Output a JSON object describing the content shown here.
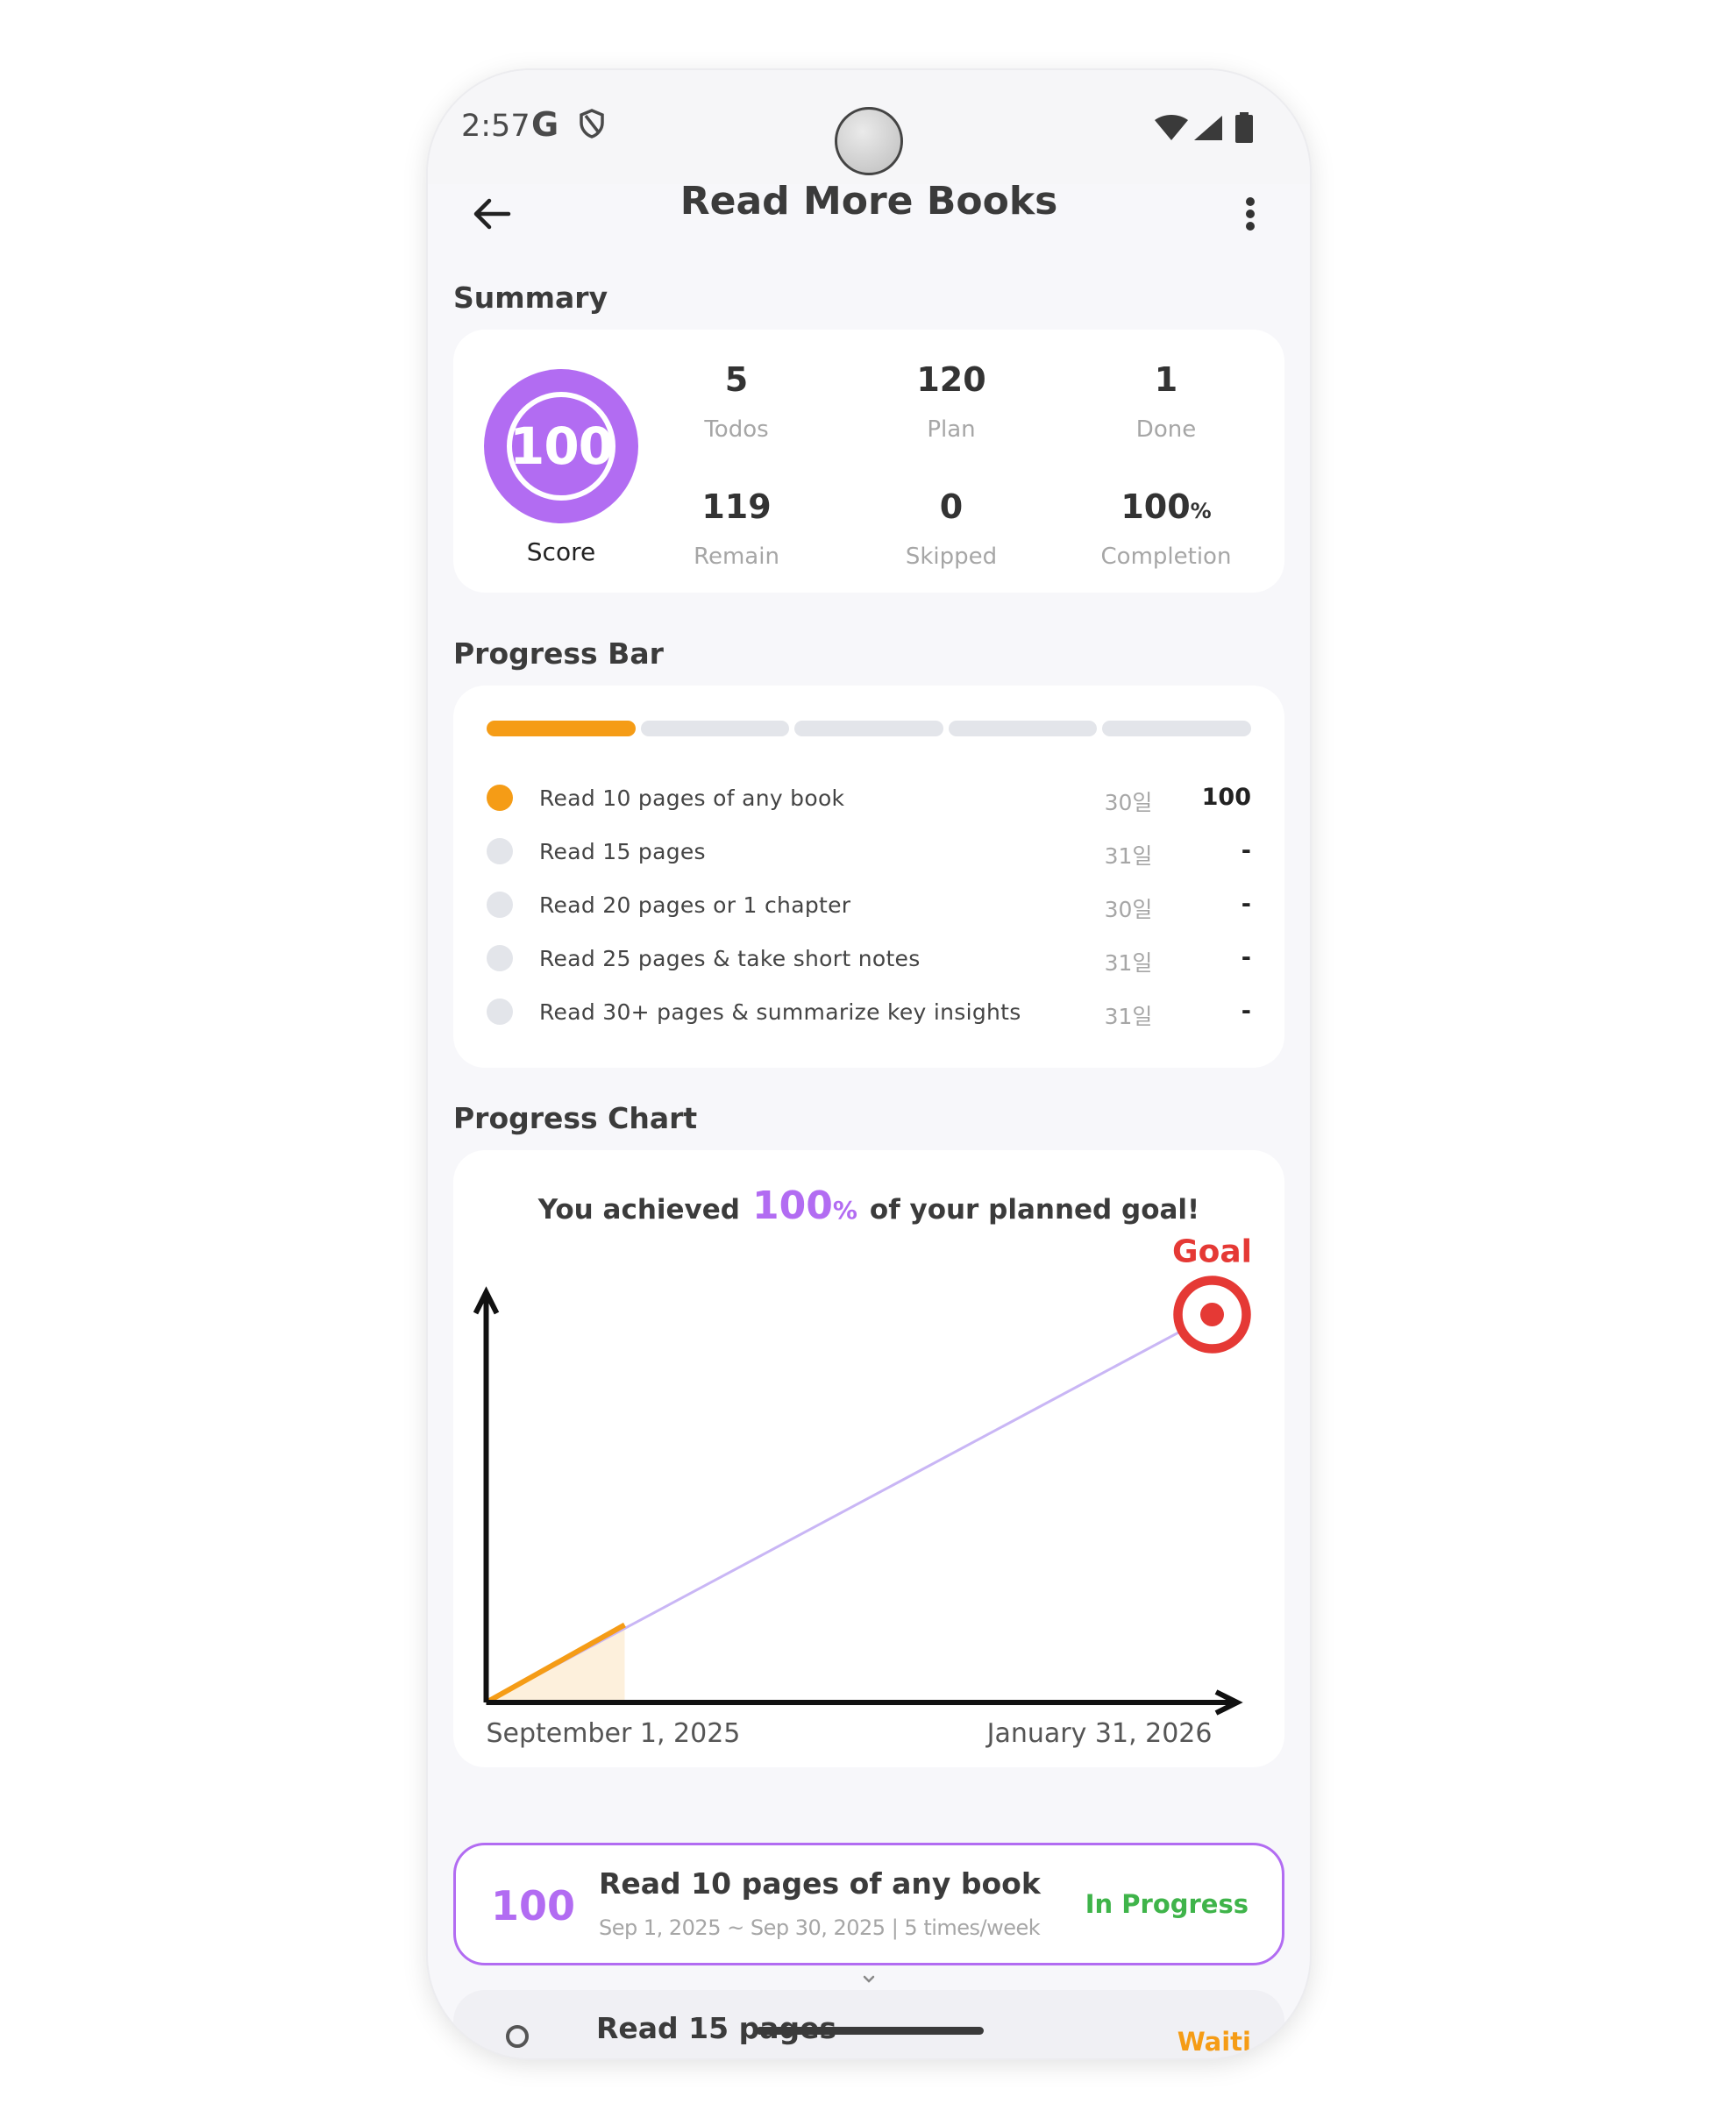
{
  "status_bar": {
    "time": "2:57",
    "g_label": "G",
    "icons": [
      "google-icon",
      "shield-icon",
      "wifi-icon",
      "signal-icon",
      "battery-icon"
    ]
  },
  "app_bar": {
    "title": "Read More Books",
    "back_icon": "arrow-left-icon",
    "menu_icon": "more-vert-icon"
  },
  "summary": {
    "section_title": "Summary",
    "score": "100",
    "score_label": "Score",
    "stats": [
      {
        "value": "5",
        "label": "Todos"
      },
      {
        "value": "120",
        "label": "Plan"
      },
      {
        "value": "1",
        "label": "Done"
      },
      {
        "value": "119",
        "label": "Remain"
      },
      {
        "value": "0",
        "label": "Skipped"
      },
      {
        "value": "100",
        "unit": "%",
        "label": "Completion"
      }
    ]
  },
  "progress_bar": {
    "section_title": "Progress Bar",
    "segments_done": 1,
    "segments_total": 5,
    "tasks": [
      {
        "label": "Read 10 pages of any book",
        "days": "30일",
        "score": "100",
        "active": true
      },
      {
        "label": "Read 15 pages",
        "days": "31일",
        "score": "-",
        "active": false
      },
      {
        "label": "Read 20 pages or 1 chapter",
        "days": "30일",
        "score": "-",
        "active": false
      },
      {
        "label": "Read 25 pages & take short notes",
        "days": "31일",
        "score": "-",
        "active": false
      },
      {
        "label": "Read 30+ pages & summarize key insights",
        "days": "31일",
        "score": "-",
        "active": false
      }
    ]
  },
  "progress_chart": {
    "section_title": "Progress Chart",
    "message_pre": "You achieved",
    "message_value": "100",
    "message_unit": "%",
    "message_post": "of your planned goal!",
    "goal_label": "Goal",
    "goal_icon": "target-icon"
  },
  "chart_data": {
    "type": "line",
    "title": "",
    "xlabel": "",
    "ylabel": "",
    "x_ticks": [
      "September 1, 2025",
      "January 31, 2026"
    ],
    "x_range": [
      "2025-09-01",
      "2026-01-31"
    ],
    "y_range": [
      0,
      600
    ],
    "series": [
      {
        "x": [
          "2025-09-01",
          "2026-01-31"
        ],
        "y": [
          0,
          600
        ],
        "color": "#c9b6f5"
      },
      {
        "x": [
          "2025-09-01",
          "2025-09-30"
        ],
        "y": [
          0,
          120
        ],
        "color": "#f59c16"
      }
    ],
    "legend": "none",
    "grid": false
  },
  "current_task": {
    "score": "100",
    "title": "Read 10 pages of any book",
    "subtitle": "Sep 1, 2025 ~ Sep 30, 2025 | 5 times/week",
    "status": "In Progress",
    "expand_icon": "chevron-down-icon"
  },
  "next_task": {
    "title": "Read 15 pages",
    "status": "Waiti"
  },
  "colors": {
    "accent": "#b26cf2",
    "progress": "#f59c16",
    "success": "#3fb44a",
    "goal": "#e53935"
  }
}
